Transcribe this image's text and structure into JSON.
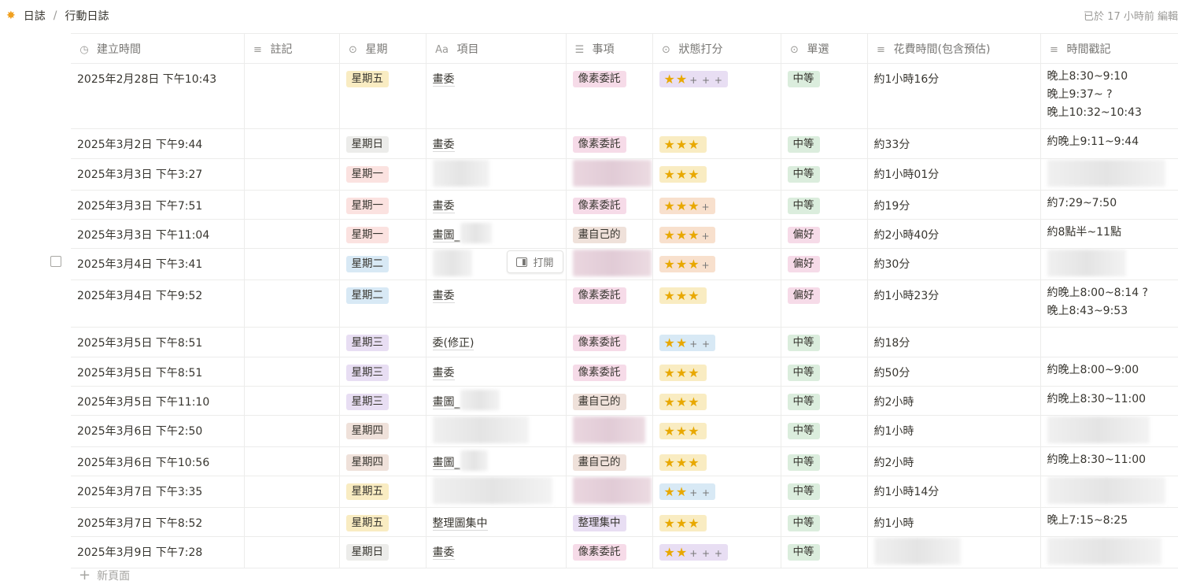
{
  "breadcrumb": {
    "root": "日誌",
    "sep": "/",
    "page": "行動日誌"
  },
  "edited": "已於 17 小時前 編輯",
  "columns": {
    "created": "建立時間",
    "notes": "註記",
    "weekday": "星期",
    "item": "項目",
    "matter": "事項",
    "status": "狀態打分",
    "single": "單選",
    "spent": "花費時間(包含預估)",
    "stamp": "時間戳記"
  },
  "colors": {
    "weekday": {
      "星期一": "#fbe2e0",
      "星期二": "#d8e9f5",
      "星期三": "#e8def3",
      "星期四": "#efe1da",
      "星期五": "#f9ecc2",
      "星期日": "#ececea"
    },
    "matter": {
      "像素委託": "#f6dbe8",
      "畫自己的": "#efe1da",
      "整理集中": "#e8def3"
    },
    "single": {
      "中等": "#dbeddd",
      "偏好": "#f6dbe8"
    },
    "status": {
      "pink": "#e8def3",
      "gold": "#f9ecc2",
      "blue": "#d8e9f5",
      "orange": "#f8e0cd"
    }
  },
  "open_button": "打開",
  "new_page": "新頁面",
  "rows": [
    {
      "created": "2025年2月28日 下午10:43",
      "weekday": "星期五",
      "item": "畫委",
      "matter": "像素委託",
      "stars": 2,
      "plus": "+ + +",
      "status_color": "pink",
      "single": "中等",
      "spent": "約1小時16分",
      "stamp": [
        "晚上8:30~9:10",
        "晚上9:37~ ?",
        "晚上10:32~10:43"
      ]
    },
    {
      "created": "2025年3月2日 下午9:44",
      "weekday": "星期日",
      "item": "畫委",
      "matter": "像素委託",
      "stars": 3,
      "plus": "",
      "status_color": "gold",
      "single": "中等",
      "spent": "約33分",
      "stamp": [
        "約晚上9:11~9:44"
      ]
    },
    {
      "created": "2025年3月3日 下午3:27",
      "weekday": "星期一",
      "item": "",
      "matter": "",
      "stars": 3,
      "plus": "",
      "status_color": "gold",
      "single": "中等",
      "spent": "約1小時01分",
      "stamp": []
    },
    {
      "created": "2025年3月3日 下午7:51",
      "weekday": "星期一",
      "item": "畫委",
      "matter": "像素委託",
      "stars": 3,
      "plus": "+",
      "status_color": "orange",
      "single": "中等",
      "spent": "約19分",
      "stamp": [
        "約7:29~7:50"
      ]
    },
    {
      "created": "2025年3月3日 下午11:04",
      "weekday": "星期一",
      "item": "畫圖_",
      "matter": "畫自己的",
      "stars": 3,
      "plus": "+",
      "status_color": "orange",
      "single": "偏好",
      "spent": "約2小時40分",
      "stamp": [
        "約8點半~11點"
      ]
    },
    {
      "created": "2025年3月4日 下午3:41",
      "weekday": "星期二",
      "item": "",
      "matter": "",
      "stars": 3,
      "plus": "+",
      "status_color": "orange",
      "single": "偏好",
      "spent": "約30分",
      "stamp": []
    },
    {
      "created": "2025年3月4日 下午9:52",
      "weekday": "星期二",
      "item": "畫委",
      "matter": "像素委託",
      "stars": 3,
      "plus": "",
      "status_color": "gold",
      "single": "偏好",
      "spent": "約1小時23分",
      "stamp": [
        "約晚上8:00~8:14 ?",
        "晚上8:43~9:53"
      ]
    },
    {
      "created": "2025年3月5日 下午8:51",
      "weekday": "星期三",
      "item": "委(修正)",
      "matter": "像素委託",
      "stars": 2,
      "plus": "+ +",
      "status_color": "blue",
      "single": "中等",
      "spent": "約18分",
      "stamp": []
    },
    {
      "created": "2025年3月5日 下午8:51",
      "weekday": "星期三",
      "item": "畫委",
      "matter": "像素委託",
      "stars": 3,
      "plus": "",
      "status_color": "gold",
      "single": "中等",
      "spent": "約50分",
      "stamp": [
        "約晚上8:00~9:00"
      ]
    },
    {
      "created": "2025年3月5日 下午11:10",
      "weekday": "星期三",
      "item": "畫圖_",
      "matter": "畫自己的",
      "stars": 3,
      "plus": "",
      "status_color": "gold",
      "single": "中等",
      "spent": "約2小時",
      "stamp": [
        "約晚上8:30~11:00"
      ]
    },
    {
      "created": "2025年3月6日 下午2:50",
      "weekday": "星期四",
      "item": "",
      "matter": "",
      "stars": 3,
      "plus": "",
      "status_color": "gold",
      "single": "中等",
      "spent": "約1小時",
      "stamp": []
    },
    {
      "created": "2025年3月6日 下午10:56",
      "weekday": "星期四",
      "item": "畫圖_",
      "matter": "畫自己的",
      "stars": 3,
      "plus": "",
      "status_color": "gold",
      "single": "中等",
      "spent": "約2小時",
      "stamp": [
        "約晚上8:30~11:00"
      ]
    },
    {
      "created": "2025年3月7日 下午3:35",
      "weekday": "星期五",
      "item": "",
      "matter": "",
      "stars": 2,
      "plus": "+ +",
      "status_color": "blue",
      "single": "中等",
      "spent": "約1小時14分",
      "stamp": []
    },
    {
      "created": "2025年3月7日 下午8:52",
      "weekday": "星期五",
      "item": "整理圖集中",
      "matter": "整理集中",
      "stars": 3,
      "plus": "",
      "status_color": "gold",
      "single": "中等",
      "spent": "約1小時",
      "stamp": [
        "晚上7:15~8:25"
      ]
    },
    {
      "created": "2025年3月9日 下午7:28",
      "weekday": "星期日",
      "item": "畫委",
      "matter": "像素委託",
      "stars": 2,
      "plus": "+ + +",
      "status_color": "pink",
      "single": "中等",
      "spent": "",
      "stamp": []
    }
  ]
}
